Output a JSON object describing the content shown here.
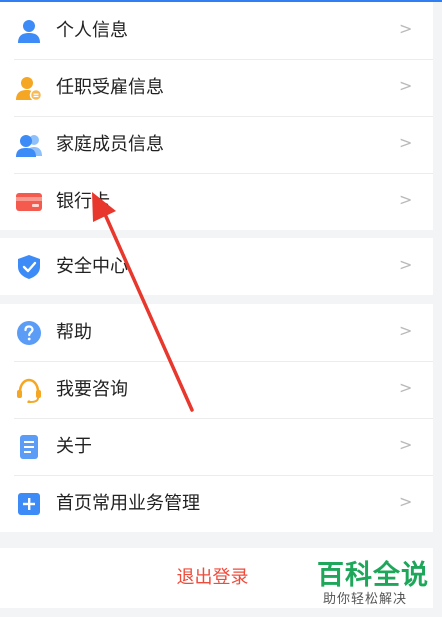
{
  "menu": {
    "group1": [
      {
        "label": "个人信息",
        "icon": "person-icon"
      },
      {
        "label": "任职受雇信息",
        "icon": "employee-badge-icon"
      },
      {
        "label": "家庭成员信息",
        "icon": "family-icon"
      },
      {
        "label": "银行卡",
        "icon": "bank-card-icon"
      }
    ],
    "group2": [
      {
        "label": "安全中心",
        "icon": "shield-check-icon"
      }
    ],
    "group3": [
      {
        "label": "帮助",
        "icon": "question-icon"
      },
      {
        "label": "我要咨询",
        "icon": "headset-icon"
      },
      {
        "label": "关于",
        "icon": "document-icon"
      },
      {
        "label": "首页常用业务管理",
        "icon": "plus-square-icon"
      }
    ],
    "chevron": ">"
  },
  "logout": {
    "label": "退出登录"
  },
  "watermark": {
    "title": "百科全说",
    "subtitle": "助你轻松解决"
  },
  "colors": {
    "accent_blue": "#2f7ff2",
    "logout_red": "#ee4b3b",
    "arrow_red": "#e8372c",
    "watermark_green": "#1ea75a"
  }
}
